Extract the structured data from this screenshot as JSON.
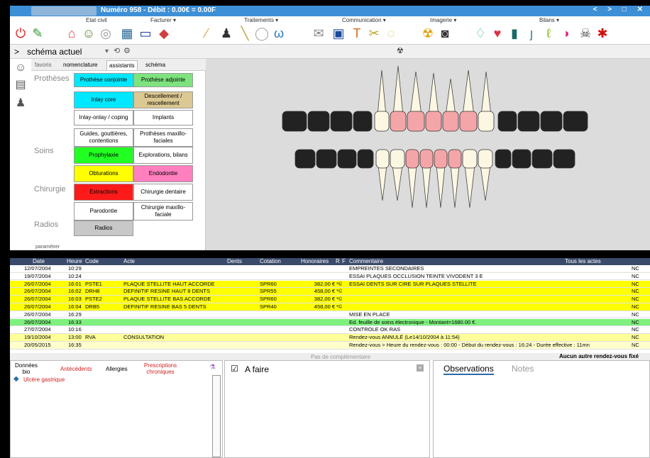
{
  "titlebar": {
    "title": "Numéro 958 - Débit : 0.00€ = 0.00F",
    "controls": "< > □ ✕"
  },
  "toolbar": {
    "groups": [
      {
        "label": "Etat civil"
      },
      {
        "label": "Facturer ▾"
      },
      {
        "label": "Traitements ▾"
      },
      {
        "label": "Communication ▾"
      },
      {
        "label": "Imagerie ▾"
      },
      {
        "label": "Bilans ▾"
      }
    ]
  },
  "schema": {
    "title": "schéma actuel",
    "arrow": ">",
    "dropdown": "▾"
  },
  "tabs": [
    "favoris",
    "nomenclature",
    "assistants",
    "schéma"
  ],
  "categories": [
    "Prothèses",
    "Soins",
    "Chirurgie",
    "Radios"
  ],
  "buttons": [
    {
      "label": "Prothèse conjointe",
      "color": "#00e8ff"
    },
    {
      "label": "Prothèse adjointe",
      "color": "#7ee37e"
    },
    {
      "label": "Inlay core",
      "color": "#00e8ff"
    },
    {
      "label": "Descellement / rescellement",
      "color": "#dcc892"
    },
    {
      "label": "Inlay-onlay / coping",
      "color": "#ffffff"
    },
    {
      "label": "Implants",
      "color": "#ffffff"
    },
    {
      "label": "Guides, gouttières, contentions",
      "color": "#ffffff"
    },
    {
      "label": "Prothèses maxillo-faciales",
      "color": "#ffffff"
    },
    {
      "label": "Prophylaxie",
      "color": "#22ff22"
    },
    {
      "label": "Explorations, bilans",
      "color": "#ffffff"
    },
    {
      "label": "Obturations",
      "color": "#ffff00"
    },
    {
      "label": "Endodontie",
      "color": "#ff7fbf"
    },
    {
      "label": "Extractions",
      "color": "#ff1a1a"
    },
    {
      "label": "Chirurgie dentaire",
      "color": "#ffffff"
    },
    {
      "label": "Parodontie",
      "color": "#ffffff"
    },
    {
      "label": "Chirurgie maxillo-faciale",
      "color": "#ffffff"
    },
    {
      "label": "Radios",
      "color": "#c8c8c8"
    }
  ],
  "param_label": "paramétrer",
  "grid": {
    "headers": [
      "Date",
      "Heure",
      "Code",
      "Acte",
      "Dents",
      "Cotation",
      "Honoraires",
      "R",
      "F",
      "Commentaire",
      "Tous les actes"
    ],
    "rows": [
      {
        "date": "12/07/2004",
        "heure": "10:29",
        "code": "",
        "acte": "",
        "cotation": "",
        "hon": "",
        "flag": "",
        "comment": "EMPREINTES SECONDAIRES",
        "nc": "NC",
        "color": "#ffffff"
      },
      {
        "date": "19/07/2004",
        "heure": "10:24",
        "code": "",
        "acte": "",
        "cotation": "",
        "hon": "",
        "flag": "",
        "comment": "ESSAI PLAQUES OCCLUSION  TEINTE VIVODENT 3 E",
        "nc": "NC",
        "color": "#ffffff"
      },
      {
        "date": "26/07/2004",
        "heure": "16:01",
        "code": "PSTE1",
        "acte": "PLAQUE STELLITE HAUT ACCORDE",
        "cotation": "SPR60",
        "hon": "382,00 €",
        "flag": "*©",
        "comment": "ESSAI DENTS SUR CIRE SUR PLAQUES STELLITE",
        "nc": "NC",
        "color": "#ffff00"
      },
      {
        "date": "26/07/2004",
        "heure": "16:02",
        "code": "DRH8",
        "acte": "DEFINITIF RESINE HAUT 8 DENTS",
        "cotation": "SPR55",
        "hon": "458,00 €",
        "flag": "*©",
        "comment": "",
        "nc": "NC",
        "color": "#ffff00"
      },
      {
        "date": "26/07/2004",
        "heure": "16:03",
        "code": "PSTE2",
        "acte": "PLAQUE STELLITE BAS ACCORDE",
        "cotation": "SPR60",
        "hon": "382,00 €",
        "flag": "*©",
        "comment": "",
        "nc": "NC",
        "color": "#ffff00"
      },
      {
        "date": "26/07/2004",
        "heure": "16:04",
        "code": "DRB5",
        "acte": "DEFINITIF RESINE BAS 5 DENTS",
        "cotation": "SPR40",
        "hon": "458,00 €",
        "flag": "*©",
        "comment": "",
        "nc": "NC",
        "color": "#ffff00"
      },
      {
        "date": "26/07/2004",
        "heure": "16:29",
        "code": "",
        "acte": "",
        "cotation": "",
        "hon": "",
        "flag": "",
        "comment": "MISE EN PLACE",
        "nc": "NC",
        "color": "#ffffff"
      },
      {
        "date": "26/07/2004",
        "heure": "16:33",
        "code": "",
        "acte": "",
        "cotation": "",
        "hon": "",
        "flag": "",
        "comment": "Ed. feuille de soins électronique - Montant=1680.00 €.",
        "nc": "NC",
        "color": "#7ef07e"
      },
      {
        "date": "27/07/2004",
        "heure": "10:16",
        "code": "",
        "acte": "",
        "cotation": "",
        "hon": "",
        "flag": "",
        "comment": "CONTROLE OK RAS",
        "nc": "NC",
        "color": "#ffffff"
      },
      {
        "date": "19/10/2004",
        "heure": "13:00",
        "code": "RVA",
        "acte": "CONSULTATION",
        "cotation": "",
        "hon": "",
        "flag": "",
        "comment": "Rendez-vous ANNULÉ (Le14/10/2004 à 11:54)",
        "nc": "NC",
        "color": "#ffff99"
      },
      {
        "date": "20/05/2015",
        "heure": "16:35",
        "code": "",
        "acte": "",
        "cotation": "",
        "hon": "",
        "flag": "",
        "comment": "Rendez-vous > Heure du rendez-vous : 00:00 - Début du rendez-vous : 16:24 - Durée effective : 11mn",
        "nc": "NC",
        "color": "#ffffcc"
      }
    ]
  },
  "no_complement": "Pas de complémentaire",
  "no_rdv": "Aucun autre rendez-vous fixé",
  "bottom": {
    "tab_donnees": "Données bio",
    "tab_antecedents": "Antécédents",
    "tab_allergies": "Allergies",
    "tab_prescriptions": "Prescriptions chroniques",
    "ulcer": "Ulcère gastrique",
    "afaire": "A faire",
    "observations": "Observations",
    "notes": "Notes"
  }
}
